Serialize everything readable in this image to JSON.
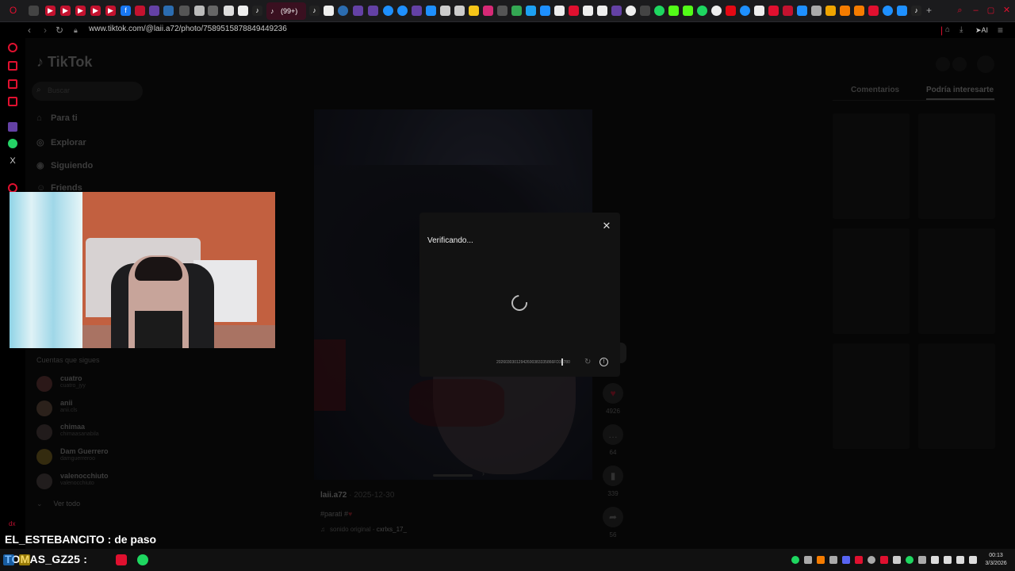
{
  "browser": {
    "active_tab_label": "(99+)",
    "url": "www.tiktok.com/@laii.a72/photo/7589515878849449236",
    "ai_label": "AI"
  },
  "tiktok": {
    "logo": "TikTok",
    "search_placeholder": "Buscar",
    "nav": [
      "Para ti",
      "Explorar",
      "Siguiendo",
      "Friends"
    ],
    "following_title": "Cuentas que sigues",
    "accounts": [
      {
        "name": "cuatro",
        "handle": "cuatro_jyy"
      },
      {
        "name": "anii",
        "handle": "anii.cls"
      },
      {
        "name": "chimaa",
        "handle": "chimaasanabila"
      },
      {
        "name": "Dam Guerrero",
        "handle": "damguerreroo"
      },
      {
        "name": "valenocchiuto",
        "handle": "valenocchiuto"
      }
    ],
    "see_all": "Ver todo",
    "post": {
      "username": "laii.a72",
      "date": "· 2025-12-30",
      "hashtag": "#parati #",
      "heart": "♥",
      "sound_prefix": "sonido original - ",
      "sound_author": "cxrlxs_17_"
    },
    "actions": [
      {
        "name": "like",
        "count": "4926",
        "icon": "heart-icon"
      },
      {
        "name": "comment",
        "count": "64",
        "icon": "comment-icon"
      },
      {
        "name": "save",
        "count": "339",
        "icon": "bookmark-icon"
      },
      {
        "name": "share",
        "count": "56",
        "icon": "share-icon"
      }
    ],
    "right_tabs": [
      "Comentarios",
      "Podría interesarte"
    ]
  },
  "modal": {
    "title": "Verificando...",
    "code": "20260303012942600383335866FD38780"
  },
  "stream_overlay": {
    "chat_message": "EL_ESTEBANCITO : de paso",
    "chat_number": "dx",
    "taskbar_user": "TOMAS_GZ25 :"
  },
  "taskbar": {
    "time": "00:13",
    "date": "3/3/2026"
  },
  "colors": {
    "accent": "#fe2c55",
    "spotify": "#1ed760",
    "opera_red": "#e0102f"
  }
}
